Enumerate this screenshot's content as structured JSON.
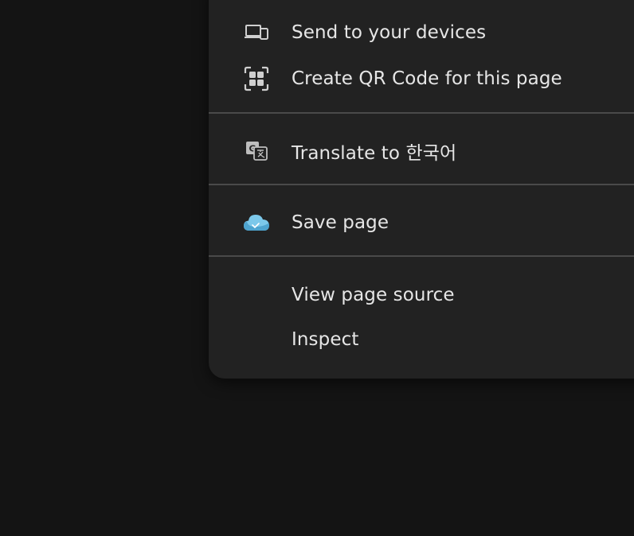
{
  "context_menu": {
    "items": [
      {
        "id": "send-to-devices",
        "label": "Send to your devices",
        "icon": "devices-icon"
      },
      {
        "id": "create-qr",
        "label": "Create QR Code for this page",
        "icon": "qr-code-icon"
      },
      {
        "id": "translate",
        "label": "Translate to 한국어",
        "icon": "translate-icon"
      },
      {
        "id": "save-page",
        "label": "Save page",
        "icon": "cloud-save-icon"
      },
      {
        "id": "view-source",
        "label": "View page source",
        "icon": ""
      },
      {
        "id": "inspect",
        "label": "Inspect",
        "icon": ""
      }
    ]
  },
  "colors": {
    "page_background": "#141414",
    "menu_background": "#222222",
    "separator": "#4a4a4a",
    "text": "#e6e6e6",
    "cloud_accent": "#7cc8ea"
  }
}
